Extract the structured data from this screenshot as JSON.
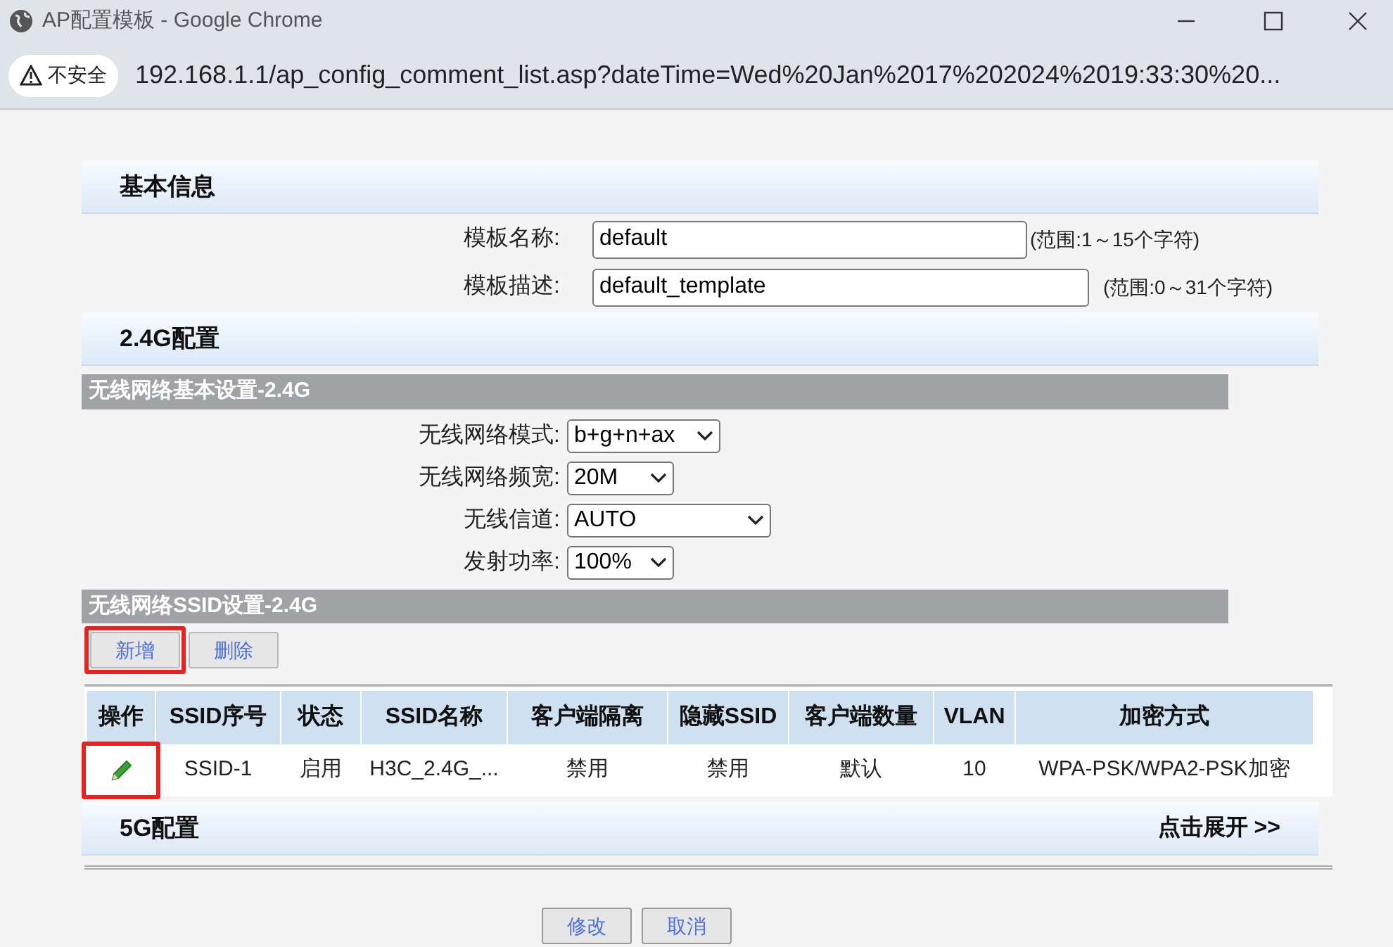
{
  "window": {
    "title": "AP配置模板 - Google Chrome"
  },
  "address_bar": {
    "security": "不安全",
    "url": "192.168.1.1/ap_config_comment_list.asp?dateTime=Wed%20Jan%2017%202024%2019:33:30%20..."
  },
  "basic_info": {
    "title": "基本信息",
    "fields": [
      {
        "label": "模板名称:",
        "value": "default",
        "hint": "(范围:1～15个字符)",
        "kind": "short"
      },
      {
        "label": "模板描述:",
        "value": "default_template",
        "hint": "(范围:0～31个字符)",
        "kind": "long"
      }
    ]
  },
  "config_24g": {
    "title": "2.4G配置",
    "basic_settings": {
      "title": "无线网络基本设置-2.4G",
      "selects": [
        {
          "label": "无线网络模式:",
          "value": "b+g+n+ax",
          "kind": "medium"
        },
        {
          "label": "无线网络频宽:",
          "value": "20M",
          "kind": "small"
        },
        {
          "label": "无线信道:",
          "value": "AUTO",
          "kind": "wide"
        },
        {
          "label": "发射功率:",
          "value": "100%",
          "kind": "small"
        }
      ]
    },
    "ssid_settings": {
      "title": "无线网络SSID设置-2.4G",
      "buttons": [
        {
          "label": "新增",
          "highlighted": true
        },
        {
          "label": "删除",
          "highlighted": false
        }
      ],
      "table": {
        "columns": [
          "操作",
          "SSID序号",
          "状态",
          "SSID名称",
          "客户端隔离",
          "隐藏SSID",
          "客户端数量",
          "VLAN",
          "加密方式"
        ],
        "rows": [
          {
            "action_highlighted": true,
            "cells": [
              "",
              "SSID-1",
              "启用",
              "H3C_2.4G_...",
              "禁用",
              "禁用",
              "默认",
              "10",
              "WPA-PSK/WPA2-PSK加密"
            ]
          }
        ]
      }
    }
  },
  "config_5g": {
    "title": "5G配置",
    "expand": "点击展开 >>"
  },
  "footer_buttons": [
    "修改",
    "取消"
  ]
}
